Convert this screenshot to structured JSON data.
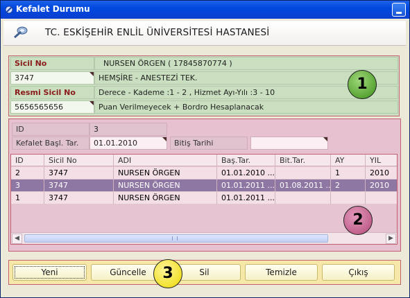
{
  "window": {
    "title": "Kefalet Durumu",
    "app_icon": "app-icon",
    "minimize_icon": "minimize-icon"
  },
  "header": {
    "hospital": "TC. ESKİŞEHİR ENLİL ÜNİVERSİTESİ HASTANESİ",
    "logo_icon": "hospital-logo-icon"
  },
  "personnel": {
    "sicil_label": "Sicil No",
    "sicil_value": "3747",
    "name_value": "NURSEN ÖRGEN ( 17845870774 )",
    "title_value": "HEMŞİRE - ANESTEZİ TEK.",
    "resmi_sicil_label": "Resmi Sicil No",
    "resmi_sicil_value": "5656565656",
    "grade_value": "Derece - Kademe :1 - 2 ,  Hizmet Ayı-Yılı :3 - 10",
    "note_value": "Puan Verilmeyecek + Bordro Hesaplanacak"
  },
  "badges": {
    "one": "1",
    "two": "2",
    "three": "3"
  },
  "form": {
    "id_label": "ID",
    "id_value": "3",
    "start_label": "Kefalet Başl. Tar.",
    "start_value": "01.01.2010",
    "end_label": "Bitiş Tarihi",
    "end_value": ""
  },
  "grid": {
    "columns": [
      "ID",
      "Sicil No",
      "ADI",
      "Baş.Tar.",
      "Bit.Tar.",
      "AY",
      "YIL"
    ],
    "rows": [
      {
        "id": "2",
        "sicil": "3747",
        "adi": "NURSEN ÖRGEN",
        "bas": "01.01.2010 ...",
        "bit": "",
        "ay": "1",
        "yil": "2010"
      },
      {
        "id": "3",
        "sicil": "3747",
        "adi": "NURSEN ÖRGEN",
        "bas": "01.01.2011 ...",
        "bit": "01.08.2011 ...",
        "ay": "2",
        "yil": "2010"
      },
      {
        "id": "1",
        "sicil": "3747",
        "adi": "NURSEN ÖRGEN",
        "bas": "01.01.2011 ...",
        "bit": "",
        "ay": "",
        "yil": ""
      }
    ],
    "selected_row": 1,
    "scroll_left": "◀",
    "scroll_right": "▶"
  },
  "buttons": {
    "new": "Yeni",
    "update": "Güncelle",
    "delete": "Sil",
    "clear": "Temizle",
    "exit": "Çıkış"
  },
  "colors": {
    "panel1": "#c9dfbf",
    "panel2": "#e8c1d0",
    "panel3": "#f5e8a8",
    "selected_row": "#8e77a3",
    "border": "#c06070"
  }
}
